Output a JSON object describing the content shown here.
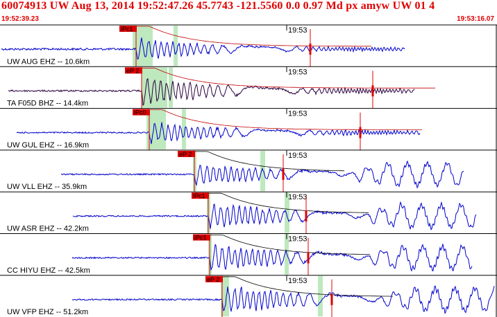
{
  "header": {
    "title": "60074913 UW Aug 13, 2014 19:52:47.26    45.7743 -121.5560   0.0 0.97 Md px amyw UW 01    4",
    "start_time": "19:52:39.23",
    "end_time": "19:53:16.07"
  },
  "colors": {
    "accent": "#e00000",
    "trace": "#0000cc",
    "trace_alt": "#2a0040",
    "coda_curve": "#000000",
    "window": "#a8e0a8"
  },
  "chart_data": {
    "type": "seismogram",
    "minute_marker": "19:53",
    "traces": [
      {
        "label": "UW AUG EHZ -- 10.6km",
        "pick": "iPc1",
        "color": "#0000cc"
      },
      {
        "label": "TA F05D BHZ -- 14.4km",
        "pick": "eP 2",
        "color": "#2a0040"
      },
      {
        "label": "UW GUL EHZ -- 16.9km",
        "pick": "iPc0",
        "color": "#0000cc"
      },
      {
        "label": "UW VLL EHZ -- 35.9km",
        "pick": "eP 2",
        "color": "#0000cc"
      },
      {
        "label": "UW ASR EHZ -- 42.2km",
        "pick": "iPc1",
        "color": "#0000cc"
      },
      {
        "label": "CC HIYU EHZ -- 42.5km",
        "pick": "iPc1",
        "color": "#0000cc"
      },
      {
        "label": "UW VFP EHZ -- 51.2km",
        "pick": "eP 2",
        "color": "#0000cc"
      }
    ]
  }
}
